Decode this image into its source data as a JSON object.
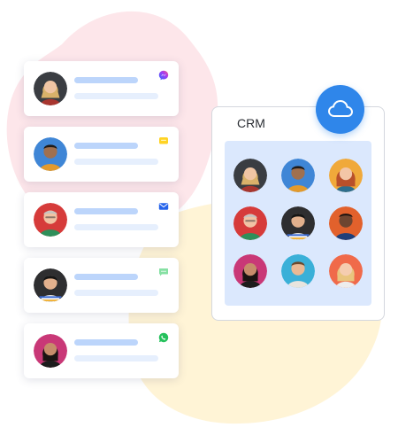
{
  "colors": {
    "blob_pink": "#fde6ea",
    "blob_yellow": "#fff4d6",
    "bar_primary": "#bcd5fb",
    "bar_secondary": "#e6effd",
    "crm_grid_bg": "#dbe8fd",
    "cloud_button": "#2f86ea"
  },
  "contacts": [
    {
      "channel": "messenger-icon"
    },
    {
      "channel": "chat-bubble-yellow-icon"
    },
    {
      "channel": "email-icon"
    },
    {
      "channel": "sms-icon"
    },
    {
      "channel": "whatsapp-icon"
    }
  ],
  "crm": {
    "title": "CRM",
    "button_icon": "cloud-icon",
    "contact_count": 9
  }
}
